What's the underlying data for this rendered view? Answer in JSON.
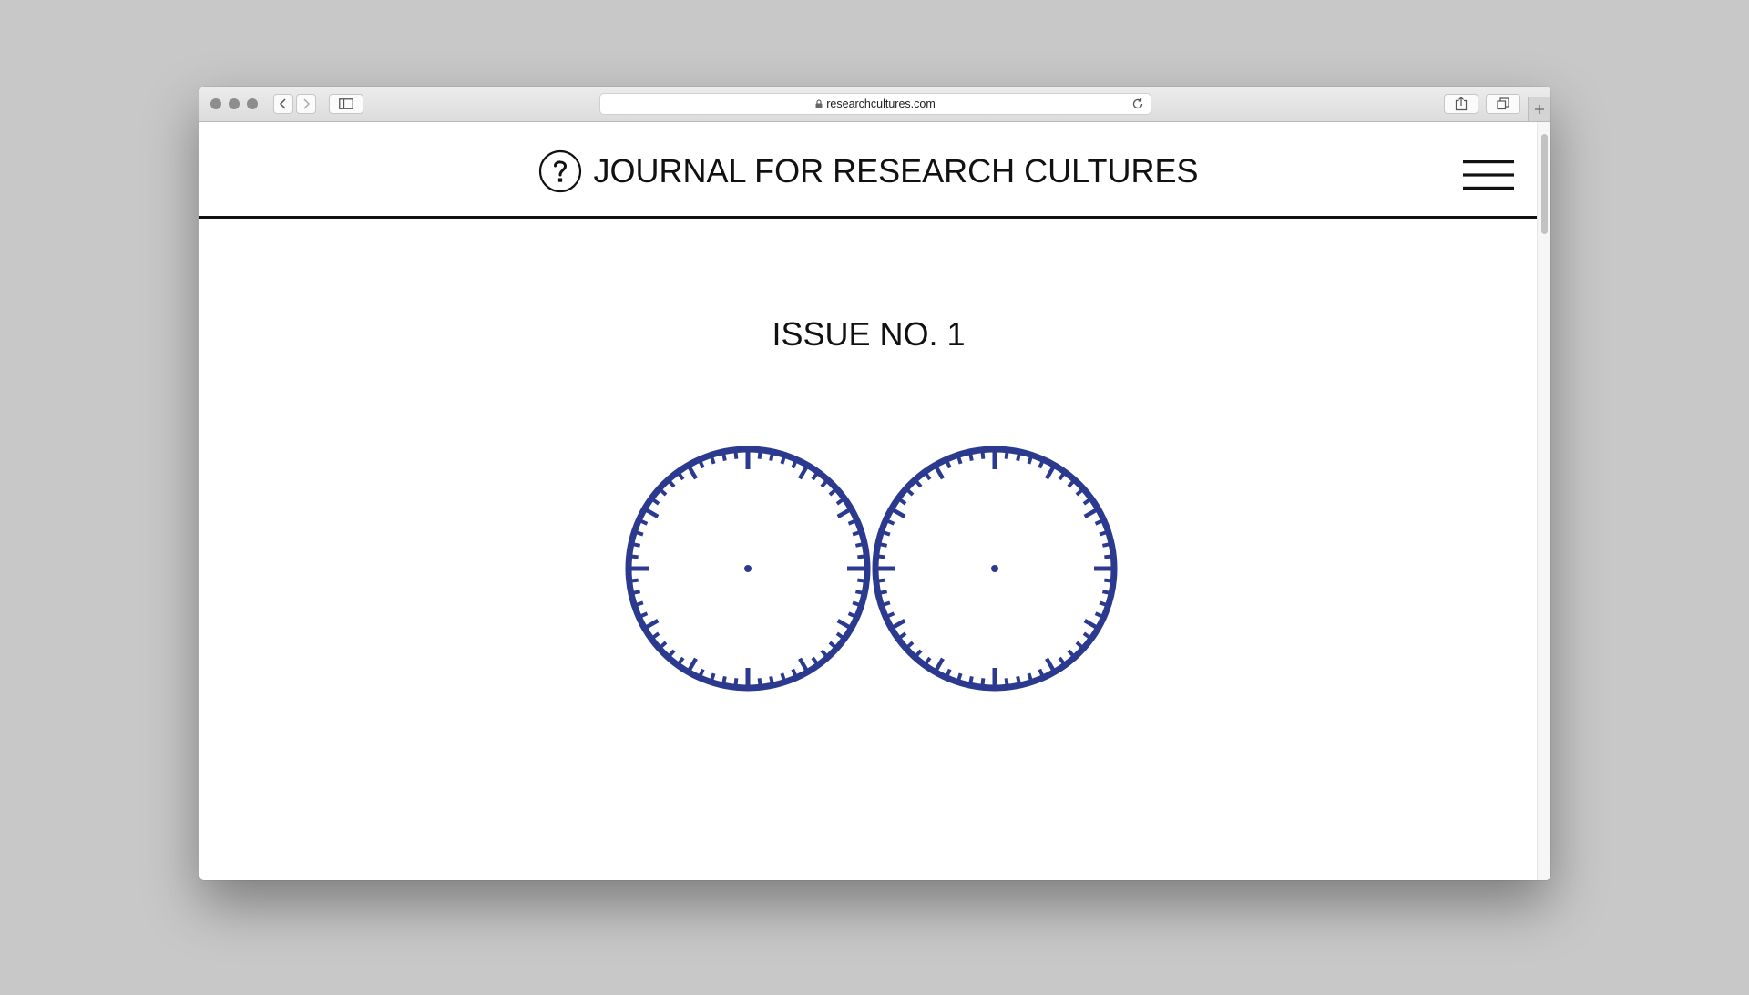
{
  "browser": {
    "url": "researchcultures.com"
  },
  "site": {
    "title": "JOURNAL FOR RESEARCH CULTURES",
    "logo_glyph": "?"
  },
  "main": {
    "issue_title": "ISSUE NO. 1"
  },
  "colors": {
    "accent": "#2b3a8f",
    "text": "#111111",
    "background": "#ffffff",
    "desk": "#c8c8c8"
  },
  "icons": [
    "lock-icon",
    "reload-icon",
    "share-icon",
    "tabs-icon",
    "plus-icon",
    "back-icon",
    "forward-icon",
    "sidebar-icon",
    "question-mark-logo-icon",
    "hamburger-menu-icon"
  ]
}
